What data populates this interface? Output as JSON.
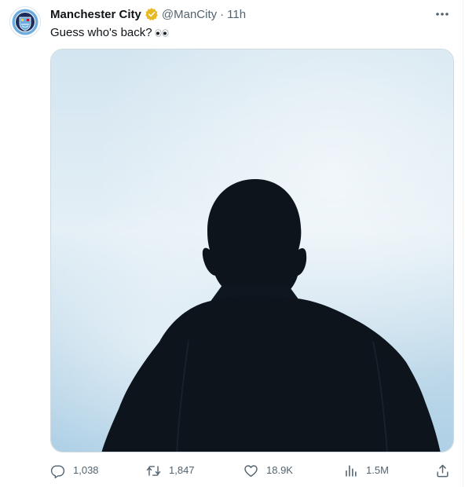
{
  "tweet": {
    "author_name": "Manchester City",
    "handle": "@ManCity",
    "separator": "·",
    "time": "11h",
    "text": "Guess who's back?",
    "verified_color": "#e8b923",
    "avatar_label": "MANCHESTER CITY"
  },
  "actions": {
    "replies": "1,038",
    "retweets": "1,847",
    "likes": "18.9K",
    "views": "1.5M"
  },
  "colors": {
    "text_primary": "#0f1419",
    "text_secondary": "#536471",
    "sky": "#d8e9f3",
    "silhouette": "#0d141c"
  }
}
